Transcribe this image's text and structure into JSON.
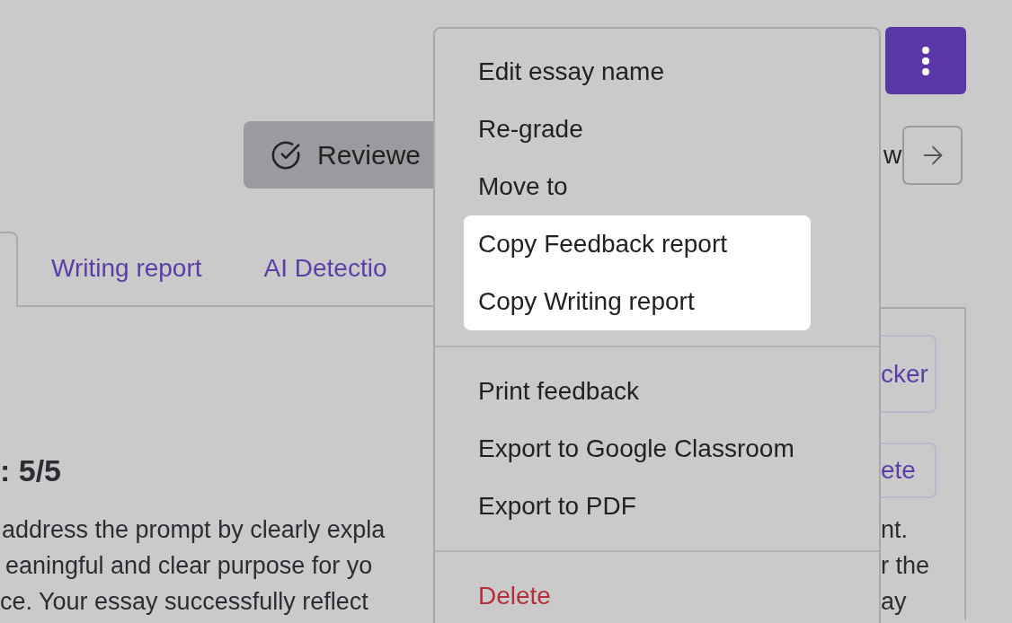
{
  "review_bar": {
    "status_button": {
      "label": "Reviewe"
    },
    "next_label": "w"
  },
  "tabs": [
    {
      "selected": true
    },
    {
      "label": "Writing report",
      "selected": false
    },
    {
      "label": "AI Detectio",
      "selected": false
    }
  ],
  "panel": {
    "buttons": [
      "cker",
      "ete"
    ],
    "score_heading": ": 5/5",
    "text_left": [
      "address the prompt by clearly expla",
      "eaningful and clear purpose for yo",
      "ce. Your essay successfully reflect"
    ],
    "text_right": [
      "nt.",
      "r the",
      "ay"
    ]
  },
  "menu": {
    "sections": [
      {
        "items": [
          {
            "label": "Edit essay name",
            "kind": "action",
            "highlighted": false
          },
          {
            "label": "Re-grade",
            "kind": "action",
            "highlighted": false
          },
          {
            "label": "Move to",
            "kind": "action",
            "highlighted": false
          },
          {
            "label": "Copy Feedback report",
            "kind": "action",
            "highlighted": true
          },
          {
            "label": "Copy Writing report",
            "kind": "action",
            "highlighted": true
          }
        ]
      },
      {
        "items": [
          {
            "label": "Print feedback",
            "kind": "action",
            "highlighted": false
          },
          {
            "label": "Export to Google Classroom",
            "kind": "action",
            "highlighted": false
          },
          {
            "label": "Export to PDF",
            "kind": "action",
            "highlighted": false
          }
        ]
      },
      {
        "items": [
          {
            "label": "Delete",
            "kind": "danger",
            "highlighted": false
          }
        ]
      }
    ]
  }
}
